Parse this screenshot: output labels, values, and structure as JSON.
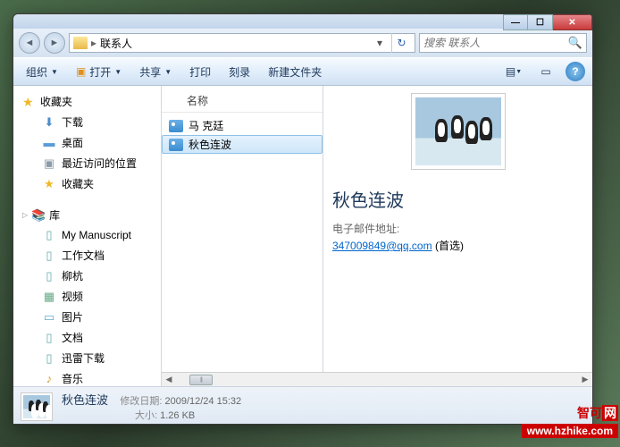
{
  "nav": {
    "path": "联系人"
  },
  "search": {
    "placeholder": "搜索 联系人"
  },
  "toolbar": {
    "organize": "组织",
    "open": "打开",
    "share": "共享",
    "print": "打印",
    "burn": "刻录",
    "newfolder": "新建文件夹"
  },
  "sidebar": {
    "favorites": "收藏夹",
    "fav_items": [
      "下载",
      "桌面",
      "最近访问的位置",
      "收藏夹"
    ],
    "libraries": "库",
    "lib_items": [
      "My Manuscript",
      "工作文档",
      "柳杭",
      "视频",
      "图片",
      "文档",
      "迅雷下载",
      "音乐"
    ]
  },
  "filelist": {
    "colname": "名称",
    "items": [
      "马 克廷",
      "秋色连波"
    ]
  },
  "preview": {
    "name": "秋色连波",
    "email_label": "电子邮件地址:",
    "email": "347009849@qq.com",
    "email_suffix": "(首选)"
  },
  "details": {
    "name": "秋色连波",
    "mod_label": "修改日期:",
    "mod_value": "2009/12/24 15:32",
    "size_label": "大小:",
    "size_value": "1.26 KB"
  },
  "watermark": {
    "brand_a": "智可",
    "brand_b": "网",
    "url": "www.hzhike.com"
  }
}
